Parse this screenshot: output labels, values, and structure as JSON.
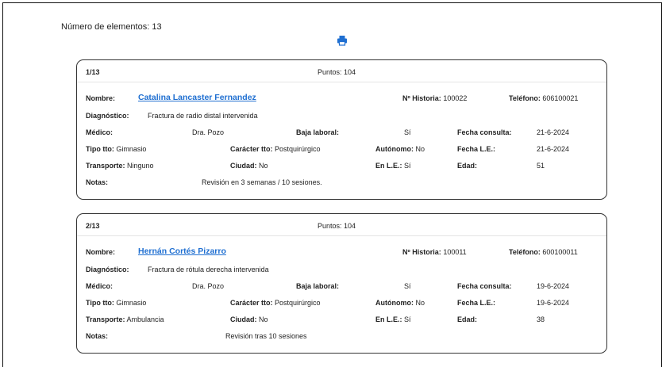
{
  "summary": {
    "label": "Número de elementos: 13"
  },
  "icons": {
    "print": "printer-icon"
  },
  "cards": [
    {
      "index": "1/13",
      "points": "Puntos: 104",
      "nombre_label": "Nombre:",
      "nombre": "Catalina Lancaster Fernandez",
      "historia_label": "Nº Historia:",
      "historia": "100022",
      "telefono_label": "Teléfono:",
      "telefono": "606100021",
      "diagnostico_label": "Diagnóstico:",
      "diagnostico": "Fractura de radio distal intervenida",
      "medico_label": "Médico:",
      "medico": "Dra. Pozo",
      "baja_label": "Baja laboral:",
      "baja": "Sí",
      "fecha_consulta_label": "Fecha consulta:",
      "fecha_consulta": "21-6-2024",
      "tipo_label": "Tipo tto:",
      "tipo": "Gimnasio",
      "caracter_label": "Carácter tto:",
      "caracter": "Postquirúrgico",
      "autonomo_label": "Autónomo:",
      "autonomo": "No",
      "fecha_le_label": "Fecha L.E.:",
      "fecha_le": "21-6-2024",
      "transporte_label": "Transporte:",
      "transporte": "Ninguno",
      "ciudad_label": "Ciudad:",
      "ciudad": "No",
      "en_le_label": "En L.E.:",
      "en_le": "Sí",
      "edad_label": "Edad:",
      "edad": "51",
      "notas_label": "Notas:",
      "notas": "Revisión en 3 semanas / 10 sesiones."
    },
    {
      "index": "2/13",
      "points": "Puntos: 104",
      "nombre_label": "Nombre:",
      "nombre": "Hernán Cortés Pizarro",
      "historia_label": "Nº Historia:",
      "historia": "100011",
      "telefono_label": "Teléfono:",
      "telefono": "600100011",
      "diagnostico_label": "Diagnóstico:",
      "diagnostico": "Fractura de rótula derecha intervenida",
      "medico_label": "Médico:",
      "medico": "Dra. Pozo",
      "baja_label": "Baja laboral:",
      "baja": "Sí",
      "fecha_consulta_label": "Fecha consulta:",
      "fecha_consulta": "19-6-2024",
      "tipo_label": "Tipo tto:",
      "tipo": "Gimnasio",
      "caracter_label": "Carácter tto:",
      "caracter": "Postquirúrgico",
      "autonomo_label": "Autónomo:",
      "autonomo": "No",
      "fecha_le_label": "Fecha L.E.:",
      "fecha_le": "19-6-2024",
      "transporte_label": "Transporte:",
      "transporte": "Ambulancia",
      "ciudad_label": "Ciudad:",
      "ciudad": "No",
      "en_le_label": "En L.E.:",
      "en_le": "Sí",
      "edad_label": "Edad:",
      "edad": "38",
      "notas_label": "Notas:",
      "notas": "Revisión tras 10 sesiones"
    }
  ]
}
